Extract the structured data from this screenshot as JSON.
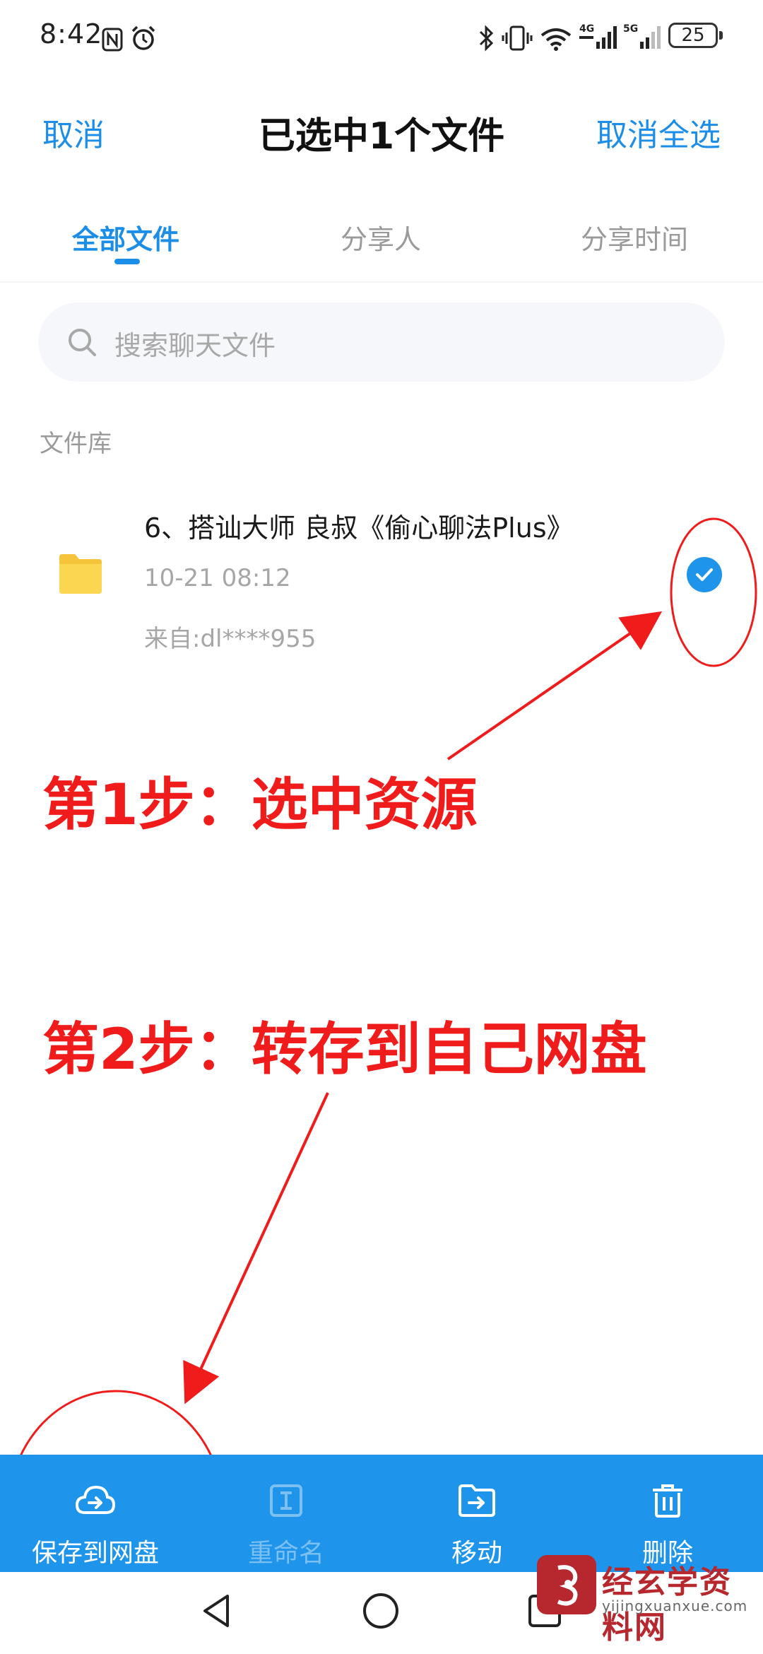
{
  "status_bar": {
    "time": "8:42",
    "battery": "25",
    "icons": [
      "nfc-icon",
      "alarm-icon",
      "bluetooth-icon",
      "vibrate-icon",
      "wifi-icon",
      "signal-4g-icon",
      "signal-5g-icon",
      "battery-icon"
    ]
  },
  "header": {
    "cancel": "取消",
    "title": "已选中1个文件",
    "deselect_all": "取消全选"
  },
  "tabs": [
    {
      "label": "全部文件",
      "active": true
    },
    {
      "label": "分享人",
      "active": false
    },
    {
      "label": "分享时间",
      "active": false
    }
  ],
  "search": {
    "placeholder": "搜索聊天文件",
    "icon": "search-icon"
  },
  "section_label": "文件库",
  "file": {
    "name": "6、搭讪大师 良叔《偷心聊法Plus》",
    "time": "10-21  08:12",
    "source": "来自:dl****955",
    "selected": true,
    "icon": "folder-icon"
  },
  "annotations": {
    "step1": "第1步：选中资源",
    "step2": "第2步：转存到自己网盘",
    "color": "#f01c1c"
  },
  "actions": [
    {
      "label": "保存到网盘",
      "icon": "cloud-upload-icon",
      "enabled": true
    },
    {
      "label": "重命名",
      "icon": "rename-icon",
      "enabled": false
    },
    {
      "label": "移动",
      "icon": "move-folder-icon",
      "enabled": true
    },
    {
      "label": "删除",
      "icon": "trash-icon",
      "enabled": true
    }
  ],
  "nav": {
    "icons": [
      "back-icon",
      "home-icon",
      "recents-icon"
    ]
  },
  "watermark": {
    "text": "经玄学资料网",
    "url": "yijingxuanxue.com"
  },
  "colors": {
    "accent": "#1d8ee8",
    "action_bar": "#1e94ea",
    "annotation": "#f01c1c"
  }
}
